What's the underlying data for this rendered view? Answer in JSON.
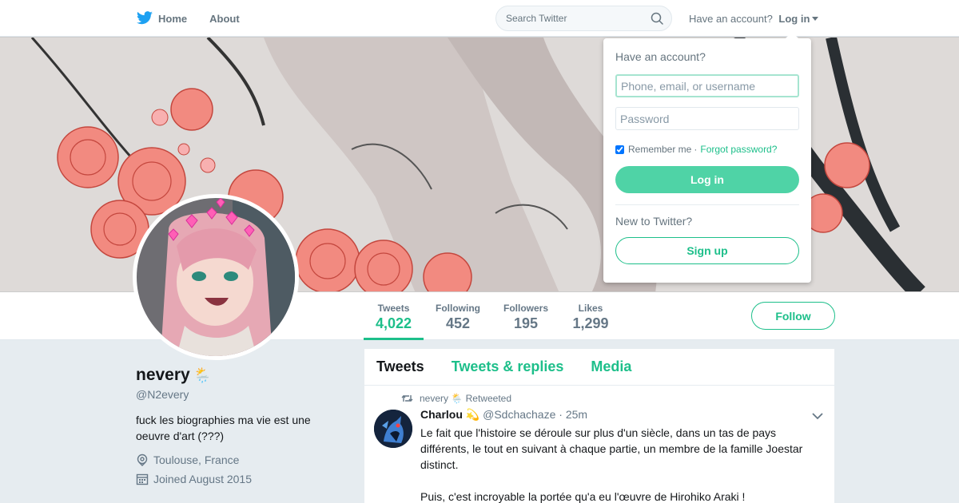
{
  "nav": {
    "home_label": "Home",
    "about_label": "About",
    "search_placeholder": "Search Twitter",
    "have_account": "Have an account?",
    "login_label": "Log in"
  },
  "profile": {
    "display_name": "nevery",
    "name_emoji": "🌦️",
    "handle": "@N2every",
    "bio_line1": "fuck les biographies ma vie est une",
    "bio_line2": "oeuvre d'art (???)",
    "location": "Toulouse, France",
    "joined": "Joined August 2015"
  },
  "stats": [
    {
      "label": "Tweets",
      "value": "4,022"
    },
    {
      "label": "Following",
      "value": "452"
    },
    {
      "label": "Followers",
      "value": "195"
    },
    {
      "label": "Likes",
      "value": "1,299"
    }
  ],
  "follow_label": "Follow",
  "timeline": {
    "tabs": [
      "Tweets",
      "Tweets & replies",
      "Media"
    ],
    "tweet": {
      "retweeted_by": "nevery 🌦️ Retweeted",
      "author": "Charlou",
      "author_emoji": "💫",
      "author_handle": "@Sdchachaze",
      "time": "· 25m",
      "text_p1": "Le fait que l'histoire se déroule sur plus d'un siècle, dans un tas de pays différents, le tout en suivant à chaque partie, un membre de la famille Joestar distinct.",
      "text_p2": "Puis, c'est incroyable la portée qu'a eu l'œuvre de Hirohiko Araki !"
    }
  },
  "login_dropdown": {
    "title": "Have an account?",
    "username_placeholder": "Phone, email, or username",
    "password_placeholder": "Password",
    "remember_label": "Remember me",
    "separator": "·",
    "forgot_label": "Forgot password?",
    "login_button": "Log in",
    "new_label": "New to Twitter?",
    "signup_button": "Sign up"
  },
  "colors": {
    "accent": "#1dbf8a",
    "brand": "#1da1f2",
    "background": "#e6ecf0"
  },
  "icons": [
    "twitter-bird-icon",
    "search-icon",
    "caret-down-icon",
    "location-icon",
    "calendar-icon",
    "retweet-icon",
    "chevron-down-icon"
  ]
}
